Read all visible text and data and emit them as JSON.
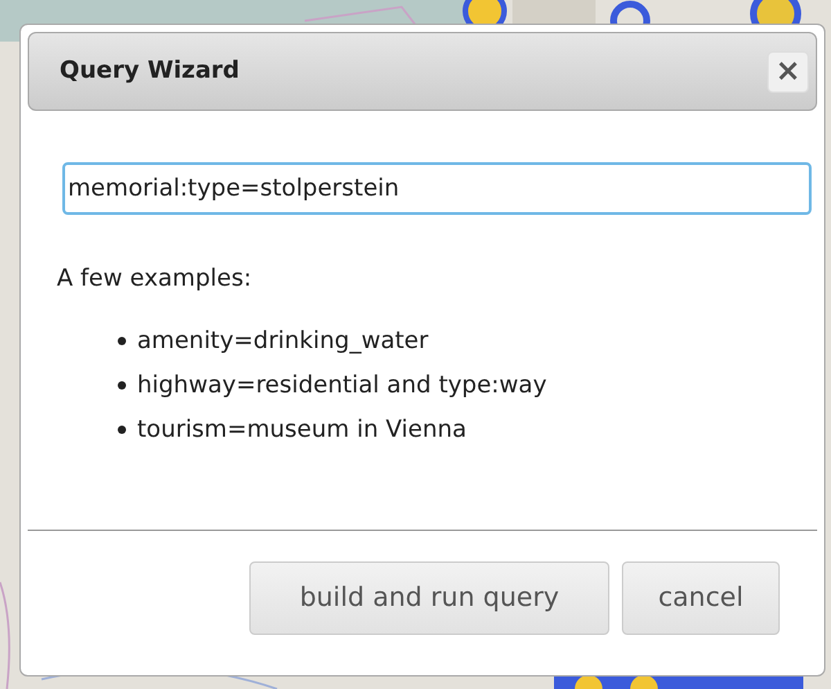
{
  "dialog": {
    "title": "Query Wizard",
    "close": "×"
  },
  "query_field": {
    "value": "memorial:type=stolperstein"
  },
  "examples_heading": "A few examples:",
  "examples": [
    "amenity=drinking_water",
    "highway=residential and type:way",
    "tourism=museum in Vienna"
  ],
  "buttons": [
    {
      "label": "build and run query",
      "kind": "primary"
    },
    {
      "label": "cancel",
      "kind": "secondary"
    }
  ]
}
